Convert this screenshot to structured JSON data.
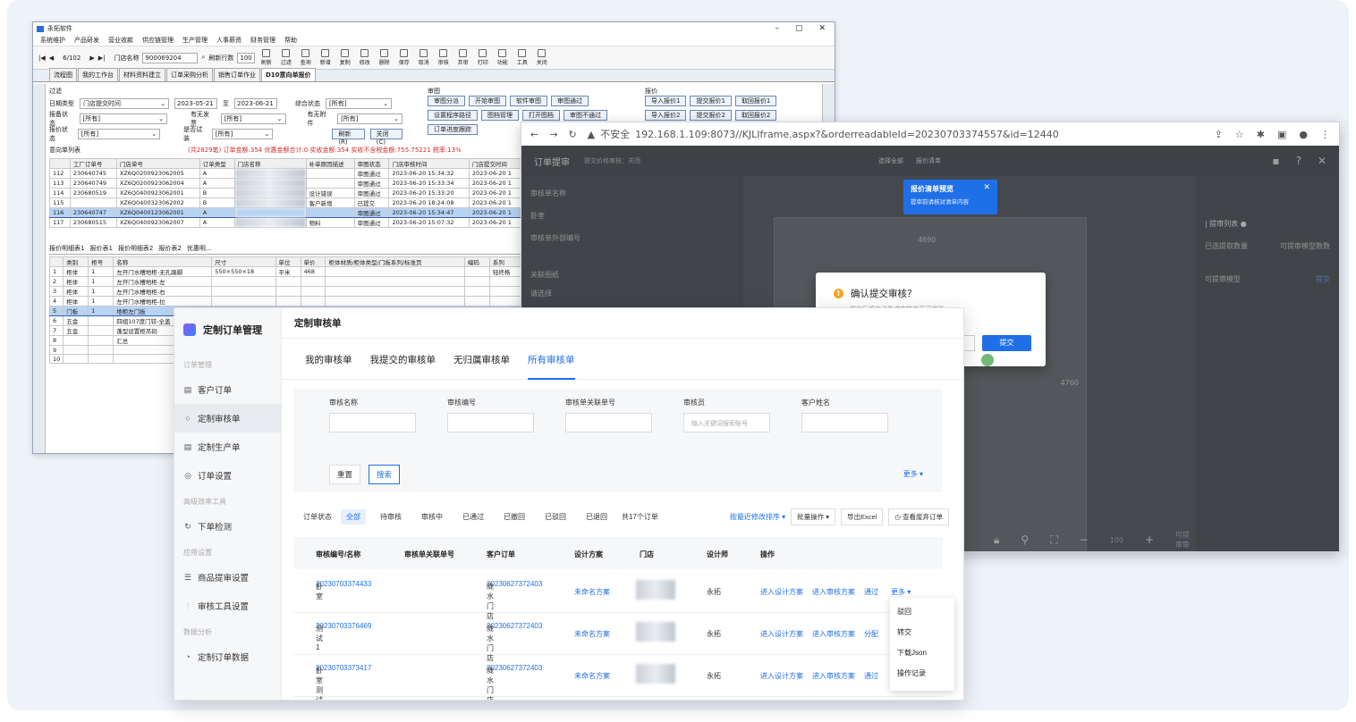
{
  "legacy": {
    "title": "永拓软件",
    "menu": [
      "系统维护",
      "产品研发",
      "营业收款",
      "供应链管理",
      "生产管理",
      "人事薪资",
      "财务管理",
      "帮助"
    ],
    "nav": {
      "first": "|◀",
      "prev": "◀",
      "pager": "6/102",
      "next": "▶",
      "last": "▶|",
      "store_label": "门店名称",
      "store_value": "900069204",
      "refresh_label": "刷新行数",
      "refresh_value": "100"
    },
    "tools": [
      "刷新",
      "过滤",
      "查询",
      "新增",
      "复制",
      "修改",
      "删除",
      "保存",
      "取消",
      "审核",
      "弃审",
      "打印",
      "功能",
      "工具",
      "关闭"
    ],
    "tabs": [
      "流程图",
      "我的工作台",
      "材料资料建立",
      "订单采购分析",
      "销售订单作业",
      "D10意向单报价"
    ],
    "filter": {
      "group_label": "过滤",
      "date_type_label": "日期类型",
      "date_type_value": "门店提交时间",
      "date_from": "2023-05-21",
      "to_label": "至",
      "date_to": "2023-06-21",
      "combined_status_label": "综合状态",
      "combined_status_value": "[所有]",
      "audit_status_label": "报备状态",
      "audit_status_value": "[所有]",
      "has_delivery_label": "有无发票",
      "has_delivery_value": "[所有]",
      "has_attachment_label": "有无附件",
      "has_attachment_value": "[所有]",
      "quote_status_label": "报价状态",
      "quote_status_value": "[所有]",
      "is_quote_label": "是否试装",
      "is_quote_value": "[所有]",
      "refresh_btn": "刷新(R)",
      "close_btn": "关闭(C)"
    },
    "audit_group": {
      "label": "审图",
      "buttons": [
        "审图分派",
        "开始审图",
        "软件审图",
        "审图通过",
        "设置程序路径",
        "图档管理",
        "打开图档",
        "审图不通过",
        "订单进度跟踪"
      ]
    },
    "quote_group": {
      "label": "报价",
      "buttons": [
        "导入报价1",
        "提交报价1",
        "取回报价1",
        "导入报价2",
        "提交报价2",
        "取回报价2"
      ]
    },
    "list_title": "意向单列表",
    "summary": "(共2829笔)  订单金额:354  优惠金额合计:0  实收金额:354  实收不含税金额:755.75221  税率:13%",
    "grid_headers": [
      "",
      "工厂订单号",
      "门店单号",
      "订单类型",
      "门店名称",
      "补单原因描述",
      "审图状态",
      "门店审核时间",
      "门店提交时间"
    ],
    "grid_rows": [
      [
        "112",
        "230640745",
        "XZ6Q0200923062005",
        "A",
        "",
        "",
        "审图通过",
        "2023-06-20 15:34:32",
        "2023-06-20 1"
      ],
      [
        "113",
        "230640749",
        "XZ6Q0200923062004",
        "A",
        "",
        "",
        "审图通过",
        "2023-06-20 15:33:34",
        "2023-06-20 1"
      ],
      [
        "114",
        "230680519",
        "XZ6Q0400923062001",
        "B",
        "",
        "设计错误",
        "审图通过",
        "2023-06-20 15:33:20",
        "2023-06-20 1"
      ],
      [
        "115",
        "",
        "XZ6Q0400323062002",
        "B",
        "",
        "客户新增",
        "已提交",
        "2023-06-20 18:24:08",
        "2023-06-20 1"
      ],
      [
        "116",
        "230640747",
        "XZ6Q0400123062001",
        "A",
        "",
        "",
        "审图通过",
        "2023-06-20 15:34:47",
        "2023-06-20 1"
      ],
      [
        "117",
        "230680515",
        "XZ6Q0400923062007",
        "A",
        "",
        "物料",
        "审图通过",
        "2023-06-20 15:07:32",
        "2023-06-20 1"
      ]
    ],
    "sub_tabs": [
      "报价明细表1",
      "报价表1",
      "报价明细表2",
      "报价表2",
      "优惠明..."
    ],
    "sub_headers": [
      "",
      "类别",
      "柜号",
      "名称",
      "尺寸",
      "单位",
      "单价",
      "柜体材质/柜体类型/门板系列/标准页",
      "编码",
      "系列"
    ],
    "sub_rows": [
      [
        "1",
        "柜体",
        "1",
        "左开门水槽地柜-无孔踢脚",
        "550×550×18",
        "平米",
        "468",
        "",
        "",
        "轻终格"
      ],
      [
        "2",
        "柜体",
        "1",
        "左开门水槽地柜-左",
        "",
        "",
        "",
        "",
        "",
        ""
      ],
      [
        "3",
        "柜体",
        "1",
        "左开门水槽地柜-右",
        "",
        "",
        "",
        "",
        "",
        ""
      ],
      [
        "4",
        "柜体",
        "1",
        "左开门水槽地柜-拉",
        "",
        "",
        "",
        "",
        "",
        ""
      ],
      [
        "5",
        "门板",
        "1",
        "地柜左门板",
        "",
        "",
        "",
        "",
        "",
        ""
      ],
      [
        "6",
        "五金",
        "",
        "四组107度门铰-全盖",
        "",
        "",
        "",
        "",
        "",
        ""
      ],
      [
        "7",
        "五金",
        "",
        "蓬型设置柜吊码",
        "",
        "",
        "",
        "",
        "",
        ""
      ],
      [
        "8",
        "",
        "",
        "汇总",
        "",
        "",
        "",
        "",
        "",
        ""
      ],
      [
        "9",
        "",
        "",
        "",
        "",
        "",
        "",
        "",
        "",
        ""
      ],
      [
        "10",
        "",
        "",
        "",
        "",
        "",
        "",
        "",
        "",
        ""
      ]
    ]
  },
  "browser": {
    "security": "不安全",
    "url": "192.168.1.109:8073//KJLIframe.aspx?&orderreadableId=20230703374557&id=12440",
    "app_title": "订单提审",
    "app_subtitle": "提交价格审核：关闭",
    "top_icons": [
      "选择全部",
      "报价清单"
    ],
    "left_items": [
      "审核单名称",
      "卧室",
      "审核单外部编号",
      "关联图纸",
      "请选择"
    ],
    "right_title": "| 提审列表 ●",
    "right_cols": [
      "已选提取数量",
      "可提审模型数数"
    ],
    "right_row": [
      "可提审模型",
      "提交"
    ],
    "dim_top": "4690",
    "dim_right": "4760",
    "tip_title": "报价清单预览",
    "tip_sub": "提审前请核对清单内容",
    "dialog_title": "确认提交审核？",
    "dialog_sub": "提交后将自动生成审核单不可撤改",
    "dialog_ok": "提交",
    "bottom_label": "可提审审",
    "zoom": "100"
  },
  "front": {
    "brand": "定制订单管理",
    "groups": {
      "order": "订单管理",
      "efficiency": "高级效率工具",
      "settings": "应用设置",
      "analysis": "数据分析"
    },
    "nav": {
      "customer_order": "客户订单",
      "audit_order": "定制审核单",
      "production_order": "定制生产单",
      "order_settings": "订单设置",
      "order_check": "下单检测",
      "product_audit": "商品提审设置",
      "audit_tool": "审核工具设置",
      "order_data": "定制订单数据"
    },
    "page_title": "定制审核单",
    "tabs": [
      "我的审核单",
      "我提交的审核单",
      "无归属审核单",
      "所有审核单"
    ],
    "filter": {
      "audit_name": "审核名称",
      "audit_no": "审核编号",
      "related_no": "审核单关联单号",
      "auditor": "审核员",
      "auditor_placeholder": "输入关键词搜索账号",
      "customer": "客户姓名",
      "reset": "重置",
      "search": "搜索",
      "more": "更多 ▾"
    },
    "status": {
      "label": "订单状态",
      "chips": [
        "全部",
        "待审核",
        "审核中",
        "已通过",
        "已撤回",
        "已驳回",
        "已退回"
      ],
      "count": "共17个订单",
      "sort": "按最近修改排序 ▾",
      "batch": "批量操作 ▾",
      "export": "导出Excel",
      "recycle": "查看废弃订单"
    },
    "headers": [
      "审核编号/名称",
      "审核单关联单号",
      "客户订单",
      "设计方案",
      "门店",
      "设计师",
      "操作"
    ],
    "rows": [
      {
        "no": "20230703374433",
        "name": "卧室",
        "order": "20230627372403",
        "order_sub": "陇水门店",
        "plan": "未命名方案",
        "designer": "永拓",
        "a1": "进入设计方案",
        "a2": "进入审核方案",
        "a3": "通过",
        "a4": "更多 ▾"
      },
      {
        "no": "20230703376469",
        "name": "测试1",
        "order": "20230627372403",
        "order_sub": "陇水门店",
        "plan": "未命名方案",
        "designer": "永拓",
        "a1": "进入设计方案",
        "a2": "进入审核方案",
        "a3": "分配",
        "a4": ""
      },
      {
        "no": "20230703373417",
        "name": "卧室测试",
        "order": "20230627372403",
        "order_sub": "陇水门店",
        "plan": "未命名方案",
        "designer": "永拓",
        "a1": "进入设计方案",
        "a2": "进入审核方案",
        "a3": "通过",
        "a4": ""
      }
    ],
    "dropdown": [
      "驳回",
      "转交",
      "下载Json",
      "操作记录"
    ]
  },
  "colors": {
    "accent": "#1f6fe6",
    "legacy_highlight": "#b9d3f3",
    "warn": "#f5a623"
  }
}
